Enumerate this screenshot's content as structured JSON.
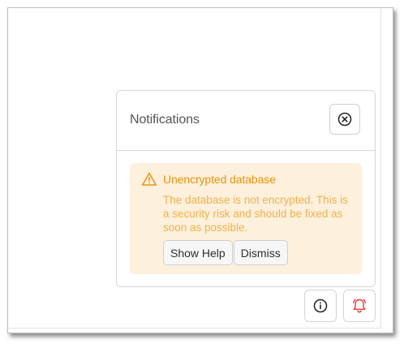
{
  "notifications": {
    "title": "Notifications",
    "close_icon": "circle-x-icon",
    "alerts": [
      {
        "severity": "warning",
        "icon": "warning-triangle-icon",
        "title": "Unencrypted database",
        "message": "The database is not encrypted. This is a security risk and should be fixed as soon as possible.",
        "actions": [
          "Show Help",
          "Dismiss"
        ]
      }
    ]
  },
  "corner_buttons": {
    "info_icon": "info-icon",
    "notifications_icon": "bell-alert-icon"
  },
  "colors": {
    "warning_text": "#e8940e",
    "warning_body": "#efb24c",
    "warning_bg": "#fdf0dc",
    "bell_icon": "#e53935"
  }
}
